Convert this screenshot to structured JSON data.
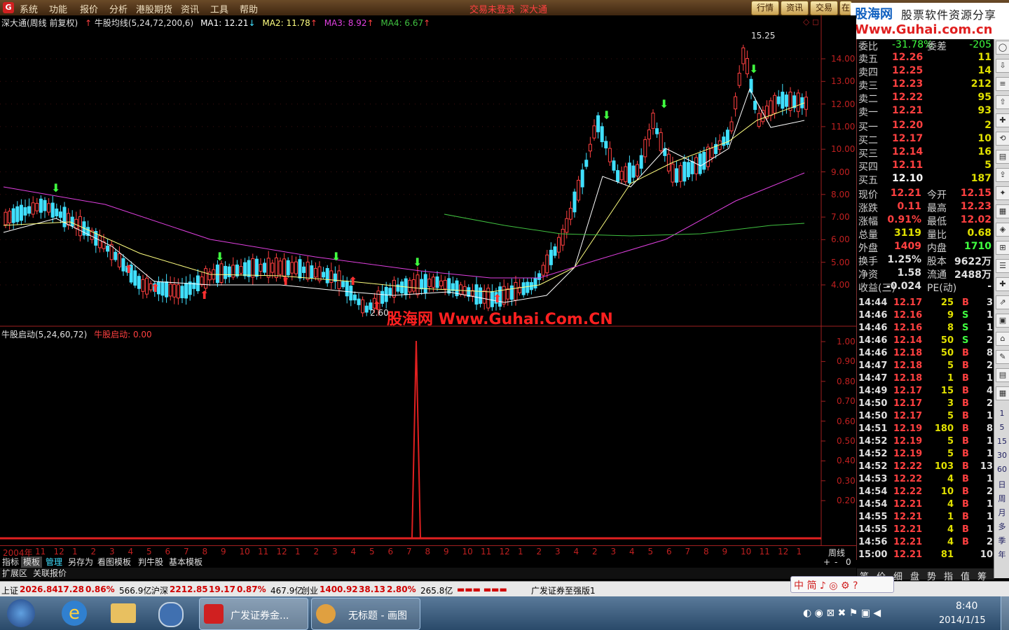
{
  "app": {
    "menu": [
      "系统",
      "功能",
      "报价",
      "分析",
      "港股期货",
      "资讯",
      "工具",
      "帮助"
    ],
    "center_title": [
      "交易未登录",
      "深大通"
    ],
    "top_buttons": [
      "行情",
      "资讯",
      "交易",
      "在"
    ]
  },
  "brand": {
    "line1": "股海网",
    "line1b": "股票软件资源分享",
    "line2": "Www.Guhai.com.cn"
  },
  "main_chart": {
    "legend": {
      "stock": "深大通(周线 前复权)",
      "indicator": "牛股均线(5,24,72,200,6)",
      "ma1": "MA1: 12.21",
      "ma2": "MA2: 11.78",
      "ma3": "MA3: 8.92",
      "ma4": "MA4: 6.67"
    },
    "price_labels": [
      "14.00",
      "13.00",
      "12.00",
      "11.00",
      "10.00",
      "9.00",
      "8.00",
      "7.00",
      "6.00",
      "5.00",
      "4.00"
    ],
    "high_label": "15.25",
    "low_label": "2.60",
    "watermark": "股海网 Www.Guhai.Com.CN",
    "colors": {
      "ma1": "#ffffff",
      "ma2": "#ffff80",
      "ma3": "#e040e0",
      "ma4": "#40c040",
      "up": "#ff4040",
      "down": "#40e0ff"
    }
  },
  "sub_chart": {
    "legend_name": "牛股启动(5,24,60,72)",
    "legend_value": "牛股启动: 0.00",
    "labels": [
      "1.00",
      "0.90",
      "0.80",
      "0.70",
      "0.60",
      "0.50",
      "0.40",
      "0.30",
      "0.20"
    ]
  },
  "time_axis": {
    "year_label": "2004年",
    "months": [
      "11",
      "12",
      "1",
      "2",
      "3",
      "4",
      "5",
      "6",
      "7",
      "8",
      "9",
      "10",
      "11",
      "12",
      "1",
      "2",
      "3",
      "4",
      "5",
      "6",
      "7",
      "8",
      "9",
      "10",
      "11",
      "12",
      "1",
      "2",
      "3",
      "4",
      "2",
      "3",
      "4",
      "5",
      "6",
      "7",
      "8",
      "9",
      "10",
      "11",
      "12",
      "1"
    ],
    "period": "周线",
    "controls": [
      "+",
      "-",
      "0"
    ]
  },
  "quote": {
    "webi": {
      "label": "委比",
      "value": "-31.78%",
      "label2": "委差",
      "value2": "-205"
    },
    "asks": [
      {
        "label": "卖五",
        "price": "12.26",
        "vol": "11"
      },
      {
        "label": "卖四",
        "price": "12.25",
        "vol": "14"
      },
      {
        "label": "卖三",
        "price": "12.23",
        "vol": "212"
      },
      {
        "label": "卖二",
        "price": "12.22",
        "vol": "95"
      },
      {
        "label": "卖一",
        "price": "12.21",
        "vol": "93"
      }
    ],
    "bids": [
      {
        "label": "买一",
        "price": "12.20",
        "vol": "2"
      },
      {
        "label": "买二",
        "price": "12.17",
        "vol": "10"
      },
      {
        "label": "买三",
        "price": "12.14",
        "vol": "16"
      },
      {
        "label": "买四",
        "price": "12.11",
        "vol": "5"
      },
      {
        "label": "买五",
        "price": "12.10",
        "vol": "187"
      }
    ],
    "stats": [
      {
        "l1": "现价",
        "v1": "12.21",
        "l2": "今开",
        "v2": "12.15"
      },
      {
        "l1": "涨跌",
        "v1": "0.11",
        "l2": "最高",
        "v2": "12.23"
      },
      {
        "l1": "涨幅",
        "v1": "0.91%",
        "l2": "最低",
        "v2": "12.02"
      },
      {
        "l1": "总量",
        "v1": "3119",
        "l2": "量比",
        "v2": "0.68"
      },
      {
        "l1": "外盘",
        "v1": "1409",
        "l2": "内盘",
        "v2": "1710"
      },
      {
        "l1": "换手",
        "v1": "1.25%",
        "l2": "股本",
        "v2": "9622万"
      },
      {
        "l1": "净资",
        "v1": "1.58",
        "l2": "流通",
        "v2": "2488万"
      },
      {
        "l1": "收益(三)",
        "v1": "-0.024",
        "l2": "PE(动)",
        "v2": "-"
      }
    ],
    "ticks": [
      {
        "t": "14:44",
        "p": "12.17",
        "v": "25",
        "s": "B",
        "n": "3"
      },
      {
        "t": "14:46",
        "p": "12.16",
        "v": "9",
        "s": "S",
        "n": "1"
      },
      {
        "t": "14:46",
        "p": "12.16",
        "v": "8",
        "s": "S",
        "n": "1"
      },
      {
        "t": "14:46",
        "p": "12.14",
        "v": "50",
        "s": "S",
        "n": "2"
      },
      {
        "t": "14:46",
        "p": "12.18",
        "v": "50",
        "s": "B",
        "n": "8"
      },
      {
        "t": "14:47",
        "p": "12.18",
        "v": "5",
        "s": "B",
        "n": "2"
      },
      {
        "t": "14:47",
        "p": "12.18",
        "v": "1",
        "s": "B",
        "n": "1"
      },
      {
        "t": "14:49",
        "p": "12.17",
        "v": "15",
        "s": "B",
        "n": "4"
      },
      {
        "t": "14:50",
        "p": "12.17",
        "v": "3",
        "s": "B",
        "n": "2"
      },
      {
        "t": "14:50",
        "p": "12.17",
        "v": "5",
        "s": "B",
        "n": "1"
      },
      {
        "t": "14:51",
        "p": "12.19",
        "v": "180",
        "s": "B",
        "n": "8"
      },
      {
        "t": "14:52",
        "p": "12.19",
        "v": "5",
        "s": "B",
        "n": "1"
      },
      {
        "t": "14:52",
        "p": "12.19",
        "v": "5",
        "s": "B",
        "n": "1"
      },
      {
        "t": "14:52",
        "p": "12.22",
        "v": "103",
        "s": "B",
        "n": "13"
      },
      {
        "t": "14:53",
        "p": "12.22",
        "v": "4",
        "s": "B",
        "n": "1"
      },
      {
        "t": "14:54",
        "p": "12.22",
        "v": "10",
        "s": "B",
        "n": "2"
      },
      {
        "t": "14:54",
        "p": "12.21",
        "v": "4",
        "s": "B",
        "n": "1"
      },
      {
        "t": "14:55",
        "p": "12.21",
        "v": "1",
        "s": "B",
        "n": "1"
      },
      {
        "t": "14:55",
        "p": "12.21",
        "v": "4",
        "s": "B",
        "n": "1"
      },
      {
        "t": "14:56",
        "p": "12.21",
        "v": "4",
        "s": "B",
        "n": "2"
      },
      {
        "t": "15:00",
        "p": "12.21",
        "v": "81",
        "s": "",
        "n": "10"
      }
    ],
    "bottom_tabs": [
      "笔",
      "价",
      "细",
      "盘",
      "势",
      "指",
      "值",
      "筹"
    ]
  },
  "toolstrip": [
    "1",
    "5",
    "15",
    "30",
    "60",
    "日",
    "周",
    "月",
    "多",
    "季",
    "年"
  ],
  "tabs_row1": [
    "指标",
    "模板",
    "管理",
    "另存为",
    "看图模板",
    "判牛股",
    "基本模板"
  ],
  "tabs_row2": [
    "扩展区",
    "关联报价"
  ],
  "status": {
    "sh_label": "上证",
    "sh_val": "2026.84",
    "sh_chg": "17.28",
    "sh_pct": "0.86%",
    "sh_amt": "566.9亿",
    "hs_label": "沪深",
    "hs_val": "2212.85",
    "hs_chg": "19.17",
    "hs_pct": "0.87%",
    "hs_amt": "467.9亿",
    "cy_label": "创业",
    "cy_val": "1400.92",
    "cy_chg": "38.13",
    "cy_pct": "2.80%",
    "cy_amt": "265.8亿",
    "version": "广发证券至强版1"
  },
  "taskbar": {
    "apps": [
      "广发证券金...",
      "无标题 - 画图"
    ],
    "time": "8:40",
    "date": "2014/1/15"
  }
}
